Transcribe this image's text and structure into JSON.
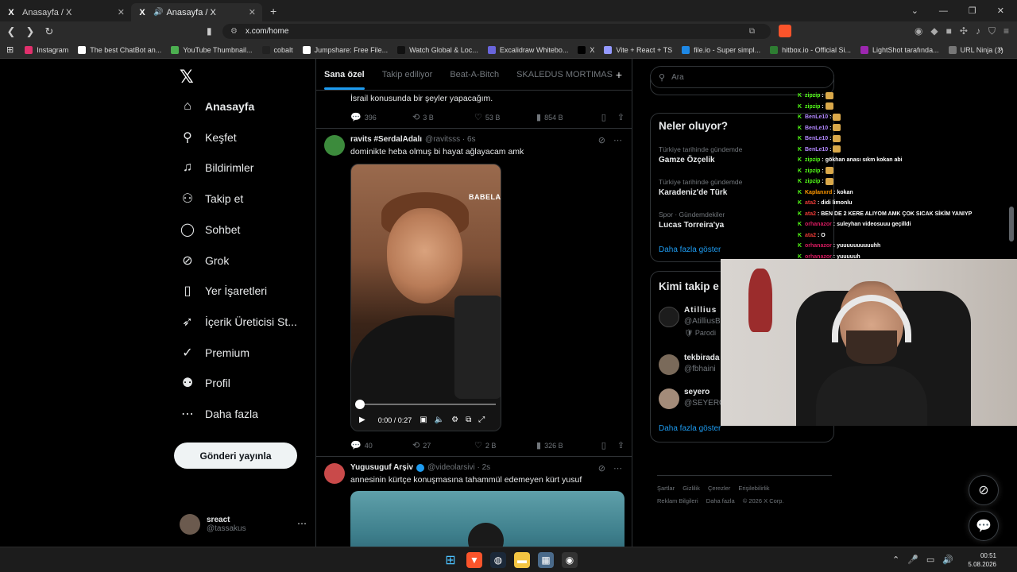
{
  "browser": {
    "tabs": [
      {
        "title": "Anasayfa / X",
        "active": false
      },
      {
        "title": "Anasayfa / X",
        "active": true
      }
    ],
    "url": "x.com/home",
    "bookmarks": [
      {
        "label": "Instagram",
        "color": "#e1306c"
      },
      {
        "label": "The best ChatBot an...",
        "color": "#ffffff"
      },
      {
        "label": "YouTube Thumbnail...",
        "color": "#4caf50"
      },
      {
        "label": "cobalt",
        "color": "#222222"
      },
      {
        "label": "Jumpshare: Free File...",
        "color": "#ffffff"
      },
      {
        "label": "Watch Global & Loc...",
        "color": "#111111"
      },
      {
        "label": "Excalidraw Whitebo...",
        "color": "#6965db"
      },
      {
        "label": "X",
        "color": "#000000"
      },
      {
        "label": "Vite + React + TS",
        "color": "#9499ff"
      },
      {
        "label": "file.io - Super simpl...",
        "color": "#1e88e5"
      },
      {
        "label": "hitbox.io - Official Si...",
        "color": "#2e7d32"
      },
      {
        "label": "LightShot tarafında...",
        "color": "#9c27b0"
      },
      {
        "label": "URL Ninja (1)",
        "color": "#777777"
      }
    ]
  },
  "sidebar": {
    "items": [
      {
        "label": "Anasayfa",
        "icon": "home-icon",
        "glyph": "⌂",
        "bold": true
      },
      {
        "label": "Keşfet",
        "icon": "search-icon",
        "glyph": "⚲",
        "bold": false
      },
      {
        "label": "Bildirimler",
        "icon": "bell-icon",
        "glyph": "♫",
        "bold": false
      },
      {
        "label": "Takip et",
        "icon": "user-plus-icon",
        "glyph": "⚇",
        "bold": false
      },
      {
        "label": "Sohbet",
        "icon": "chat-icon",
        "glyph": "◯",
        "bold": false
      },
      {
        "label": "Grok",
        "icon": "grok-icon",
        "glyph": "⊘",
        "bold": false
      },
      {
        "label": "Yer İşaretleri",
        "icon": "bookmark-icon",
        "glyph": "▯",
        "bold": false
      },
      {
        "label": "İçerik Üreticisi St...",
        "icon": "rocket-icon",
        "glyph": "➶",
        "bold": false
      },
      {
        "label": "Premium",
        "icon": "premium-icon",
        "glyph": "✓",
        "bold": false
      },
      {
        "label": "Profil",
        "icon": "profile-icon",
        "glyph": "⚉",
        "bold": false
      },
      {
        "label": "Daha fazla",
        "icon": "more-icon",
        "glyph": "⋯",
        "bold": false
      }
    ],
    "post_button": "Gönderi yayınla",
    "profile": {
      "name": "sreact",
      "handle": "@tassakus"
    }
  },
  "main": {
    "tabs": [
      "Sana özel",
      "Takip ediliyor",
      "Beat-A-Bitch",
      "SKALEDUS MORTIMAS"
    ],
    "prev_tweet": {
      "text": "İsrail konusunda bir şeyler yapacağım.",
      "replies": "396",
      "reposts": "3 B",
      "likes": "53 B",
      "views": "854 B"
    },
    "tweets": [
      {
        "name": "ravits #SerdalAdalı",
        "handle": "@ravitsss · 6s",
        "text": "dominikte heba olmuş bi hayat ağlayacam amk",
        "video": {
          "brand": "BABELA",
          "time": "0:00 / 0:27"
        },
        "replies": "40",
        "reposts": "27",
        "likes": "2 B",
        "views": "326 B"
      },
      {
        "name": "Yugusuguf Arşiv",
        "handle": "@videolarsivi · 2s",
        "text": "annesinin kürtçe konuşmasına tahammül edemeyen kürt yusuf"
      }
    ]
  },
  "right": {
    "search_placeholder": "Ara",
    "trends_title": "Neler oluyor?",
    "trends": [
      {
        "meta": "Türkiye tarihinde gündemde",
        "name": "Gamze Özçelik"
      },
      {
        "meta": "Türkiye tarihinde gündemde",
        "name": "Karadeniz'de Türk"
      },
      {
        "meta": "Spor · Gündemdekiler",
        "name": "Lucas Torreira'ya"
      }
    ],
    "trends_more": "Daha fazla göster",
    "follow_title": "Kimi takip e",
    "follow": [
      {
        "name": "Atillius",
        "handle": "@AtilliusB",
        "sub": "🛡 Parodi"
      },
      {
        "name": "tekbirada",
        "handle": "@fbhaini",
        "sub": ""
      },
      {
        "name": "seyero",
        "handle": "@SEYERO",
        "sub": ""
      }
    ],
    "follow_more": "Daha fazla göster",
    "footer": [
      "Şartlar",
      "Gizlilik",
      "Çerezler",
      "Erişilebilirlik",
      "Reklam Bilgileri",
      "Daha fazla",
      "© 2026 X Corp."
    ]
  },
  "chat": [
    {
      "user": "zipzip",
      "msg": "",
      "emote": true,
      "color": "#53fc18"
    },
    {
      "user": "zipzip",
      "msg": "",
      "emote": true,
      "color": "#53fc18"
    },
    {
      "user": "BenLe10",
      "msg": "",
      "emote": true,
      "color": "#b388ff"
    },
    {
      "user": "BenLe10",
      "msg": "",
      "emote": true,
      "color": "#b388ff"
    },
    {
      "user": "BenLe10",
      "msg": "",
      "emote": true,
      "color": "#b388ff"
    },
    {
      "user": "BenLe10",
      "msg": "",
      "emote": true,
      "color": "#b388ff"
    },
    {
      "user": "zipzip",
      "msg": "gökhan anası sıkm kokan abi",
      "emote": false,
      "color": "#53fc18"
    },
    {
      "user": "zipzip",
      "msg": "",
      "emote": true,
      "color": "#53fc18"
    },
    {
      "user": "zipzip",
      "msg": "",
      "emote": true,
      "color": "#53fc18"
    },
    {
      "user": "Kaplanxrd",
      "msg": "kokan",
      "emote": false,
      "color": "#ff9800"
    },
    {
      "user": "ata2",
      "msg": "didi limonlu",
      "emote": false,
      "color": "#e53935"
    },
    {
      "user": "ata2",
      "msg": "BEN DE 2 KERE ALIYOM AMK ÇOK SICAK SİKİM YANIYP",
      "emote": false,
      "color": "#e53935"
    },
    {
      "user": "orhanazor",
      "msg": "suleyhan videosuuu geçilldi",
      "emote": false,
      "color": "#d81b60"
    },
    {
      "user": "ata2",
      "msg": "O",
      "emote": false,
      "color": "#e53935"
    },
    {
      "user": "orhanazor",
      "msg": "yuuuuuuuuuuhh",
      "emote": false,
      "color": "#d81b60"
    },
    {
      "user": "orhanazor",
      "msg": "yuuuuuh",
      "emote": false,
      "color": "#d81b60"
    }
  ],
  "taskbar": {
    "time": "00:51",
    "date": "5.08.2026"
  }
}
